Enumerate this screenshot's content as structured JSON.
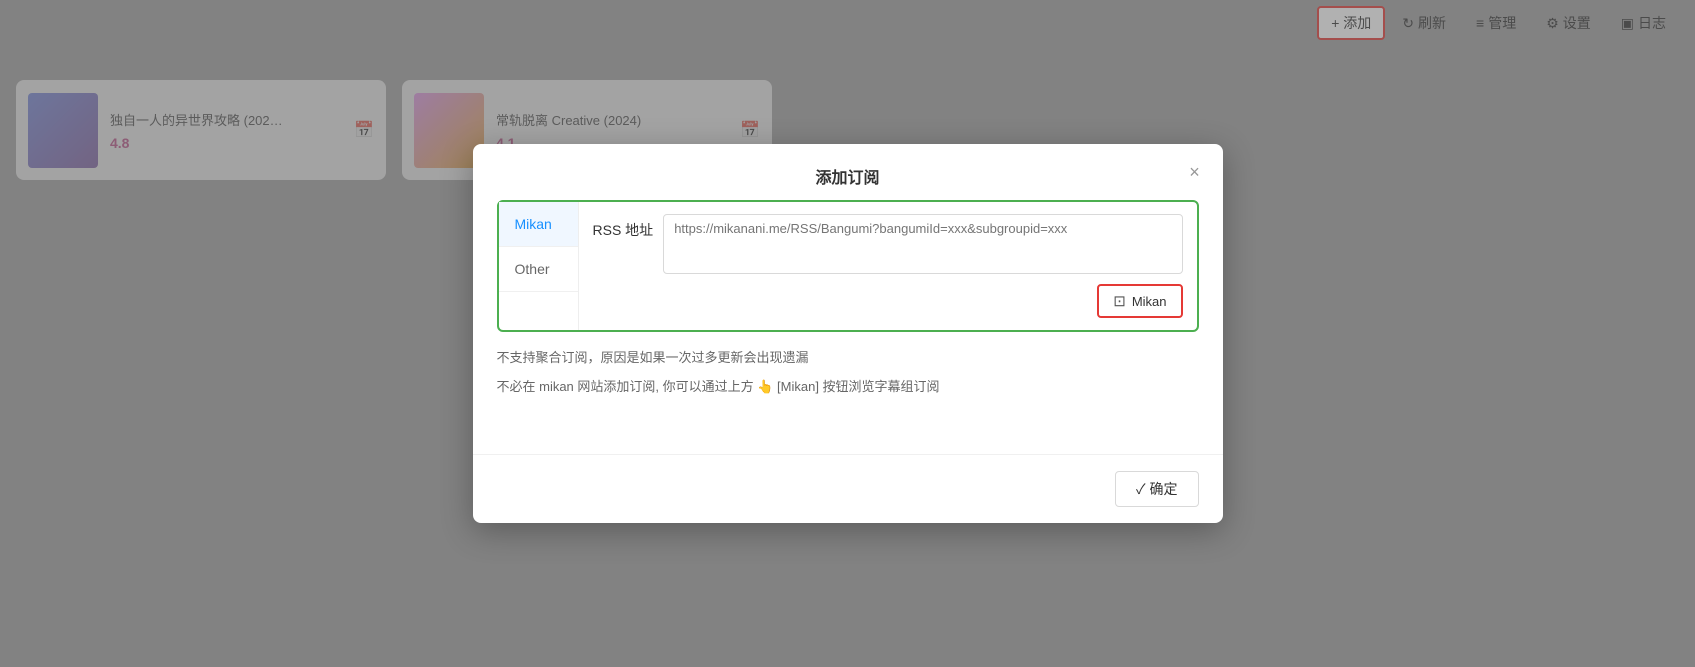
{
  "toolbar": {
    "add_label": "+ 添加",
    "refresh_label": "刷新",
    "manage_label": "管理",
    "settings_label": "设置",
    "log_label": "日志"
  },
  "cards": [
    {
      "title": "独自一人的异世界攻略 (202…",
      "rating": "4.8",
      "thumb_class": "card1"
    },
    {
      "title": "常轨脱离 Creative (2024)",
      "rating": "4.1",
      "thumb_class": "card2"
    }
  ],
  "dialog": {
    "title": "添加订阅",
    "close_label": "×",
    "tabs": [
      {
        "label": "Mikan",
        "active": true
      },
      {
        "label": "Other",
        "active": false
      }
    ],
    "rss_label": "RSS 地址",
    "rss_placeholder": "https://mikanani.me/RSS/Bangumi?bangumiId=xxx&subgroupid=xxx",
    "mikan_btn_label": "Mikan",
    "info_line1": "不支持聚合订阅，原因是如果一次过多更新会出现遗漏",
    "info_line2": "不必在 mikan 网站添加订阅, 你可以通过上方 👆 [Mikan] 按钮浏览字幕组订阅",
    "confirm_label": "✓ 确定"
  },
  "icons": {
    "refresh": "↻",
    "manage": "≡",
    "settings": "⚙",
    "log": "▣",
    "calendar": "📅",
    "mikan_icon": "⊡"
  }
}
